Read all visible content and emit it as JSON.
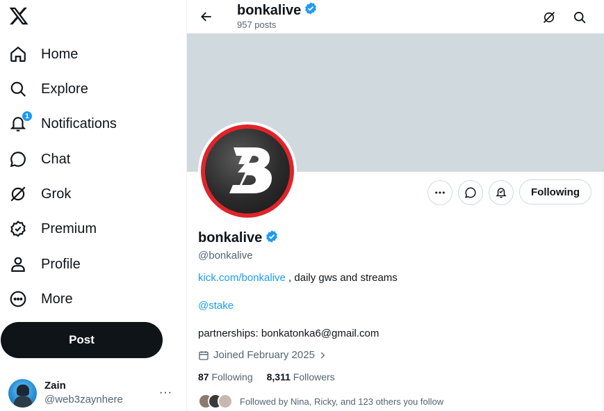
{
  "sidebar": {
    "logo_icon": "x-logo-icon",
    "items": [
      {
        "label": "Home",
        "icon": "home-icon"
      },
      {
        "label": "Explore",
        "icon": "search-icon"
      },
      {
        "label": "Notifications",
        "icon": "bell-icon",
        "badge": "1"
      },
      {
        "label": "Chat",
        "icon": "chat-bubble-icon"
      },
      {
        "label": "Grok",
        "icon": "grok-icon"
      },
      {
        "label": "Premium",
        "icon": "verified-badge-icon"
      },
      {
        "label": "Profile",
        "icon": "person-icon"
      },
      {
        "label": "More",
        "icon": "more-circle-icon"
      }
    ],
    "post_label": "Post",
    "account": {
      "name": "Zain",
      "handle": "@web3zaynhere",
      "more": "···"
    }
  },
  "header": {
    "title": "bonkalive",
    "posts_count": "957 posts"
  },
  "profile": {
    "name": "bonkalive",
    "handle": "@bonkalive",
    "bio_link": "kick.com/bonkalive",
    "bio_text": " , daily gws and streams",
    "mention": "@stake",
    "partnerships": "partnerships: bonkatonka6@gmail.com",
    "joined": "Joined February 2025",
    "following_count": "87",
    "following_label": "Following",
    "followers_count": "8,311",
    "followers_label": "Followers",
    "followed_by": "Followed by Nina, Ricky, and 123 others you follow",
    "following_button": "Following",
    "avatar_letter": "B"
  },
  "colors": {
    "accent": "#1d9bf0",
    "text": "#0f1419",
    "muted": "#536471",
    "banner": "#cfd9de",
    "avatar_red": "#e0242b"
  }
}
